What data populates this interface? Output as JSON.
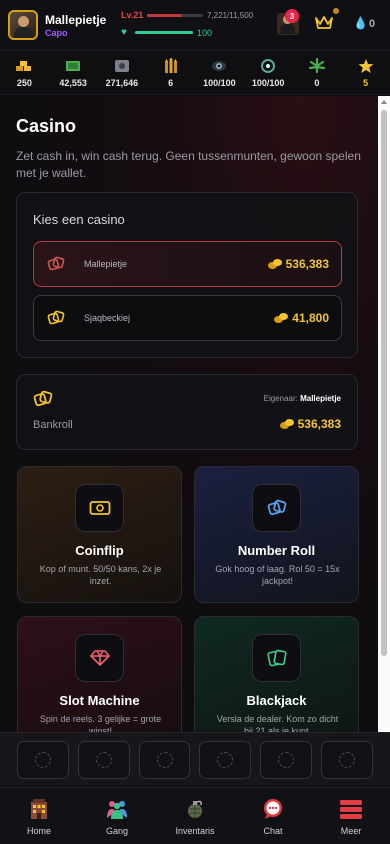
{
  "header": {
    "username": "Mallepietje",
    "rank": "Capo",
    "level": "Lv.21",
    "xp_text": "7,221/11,500",
    "xp_fraction": 0.628,
    "hp_text": "100",
    "hp_fraction": 1.0,
    "notification_count": "3",
    "diamonds": "0"
  },
  "resources": [
    {
      "icon": "gold-bars-icon",
      "value": "250"
    },
    {
      "icon": "cash-icon",
      "value": "42,553"
    },
    {
      "icon": "safe-icon",
      "value": "271,646"
    },
    {
      "icon": "ammo-icon",
      "value": "6"
    },
    {
      "icon": "eye-icon",
      "value": "100/100"
    },
    {
      "icon": "target-icon",
      "value": "100/100"
    },
    {
      "icon": "cannabis-icon",
      "value": "0"
    },
    {
      "icon": "star-icon",
      "value": "5"
    }
  ],
  "page": {
    "title": "Casino",
    "subtitle": "Zet cash in, win cash terug. Geen tussenmunten, gewoon spelen met je wallet."
  },
  "casino_picker": {
    "title": "Kies een casino",
    "casinos": [
      {
        "name": "Mallepietje",
        "amount": "536,383",
        "selected": true
      },
      {
        "name": "Sjaqbeckiej",
        "amount": "41,800",
        "selected": false
      }
    ]
  },
  "bankroll": {
    "label": "Bankroll",
    "owner_label": "Eigenaar:",
    "owner": "Mallepietje",
    "amount": "536,383"
  },
  "games": [
    {
      "name": "Coinflip",
      "desc": "Kop of munt. 50/50 kans, 2x je inzet.",
      "icon": "banknote-icon"
    },
    {
      "name": "Number Roll",
      "desc": "Gok hoog of laag. Rol 50 = 15x jackpot!",
      "icon": "dice-icon"
    },
    {
      "name": "Slot Machine",
      "desc": "Spin de reels. 3 gelijke = grote winst!",
      "icon": "gem-icon"
    },
    {
      "name": "Blackjack",
      "desc": "Versla de dealer. Kom zo dicht bij 21 als je kunt.",
      "icon": "cards-icon"
    }
  ],
  "nav": [
    {
      "label": "Home",
      "icon": "building-icon"
    },
    {
      "label": "Gang",
      "icon": "people-icon"
    },
    {
      "label": "Inventaris",
      "icon": "grenade-icon"
    },
    {
      "label": "Chat",
      "icon": "chat-icon"
    },
    {
      "label": "Meer",
      "icon": "menu-icon"
    }
  ],
  "colors": {
    "accent_gold": "#f4c430",
    "accent_red": "#b23a3d",
    "hp_green": "#2ecc8e",
    "rank_purple": "#a259ff"
  }
}
